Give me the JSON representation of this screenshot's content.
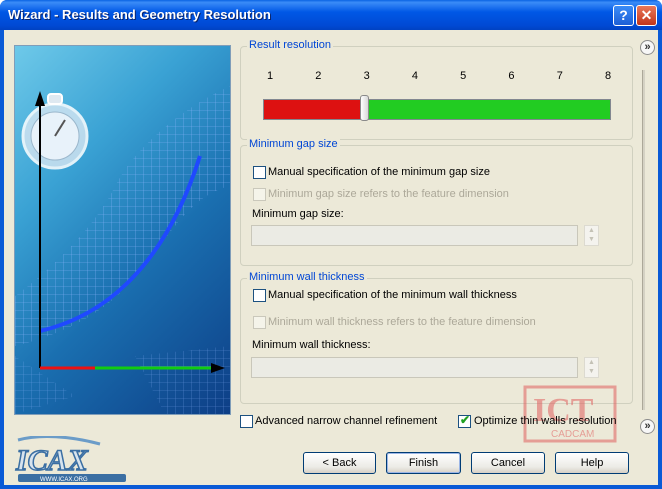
{
  "window": {
    "title": "Wizard - Results and Geometry Resolution",
    "help_icon": "question-icon",
    "close_icon": "close-icon"
  },
  "result_resolution": {
    "title": "Result resolution",
    "ticks": [
      "1",
      "2",
      "3",
      "4",
      "5",
      "6",
      "7",
      "8"
    ],
    "value": 3,
    "min": 1,
    "max": 8,
    "low_color": "#dd1111",
    "high_color": "#22cc22"
  },
  "min_gap": {
    "title": "Minimum gap size",
    "manual_label": "Manual specification of the minimum gap size",
    "manual_checked": false,
    "feature_label": "Minimum gap size refers to the feature dimension",
    "feature_checked": false,
    "size_label": "Minimum gap size:",
    "size_value": ""
  },
  "min_wall": {
    "title": "Minimum wall thickness",
    "manual_label": "Manual specification of the minimum wall thickness",
    "manual_checked": false,
    "feature_label": "Minimum wall thickness refers to the feature dimension",
    "feature_checked": false,
    "size_label": "Minimum wall thickness:",
    "size_value": ""
  },
  "options": {
    "advanced_label": "Advanced narrow channel refinement",
    "advanced_checked": false,
    "thin_walls_label": "Optimize thin walls resolution",
    "thin_walls_checked": true
  },
  "buttons": {
    "back": "< Back",
    "finish": "Finish",
    "cancel": "Cancel",
    "help": "Help"
  },
  "logo": {
    "name": "ICAX",
    "url": "WWW.ICAX.ORG"
  },
  "watermark": {
    "text": "ICT",
    "sub": "CADCAM"
  },
  "more_icon": "chevron-double-right-icon"
}
